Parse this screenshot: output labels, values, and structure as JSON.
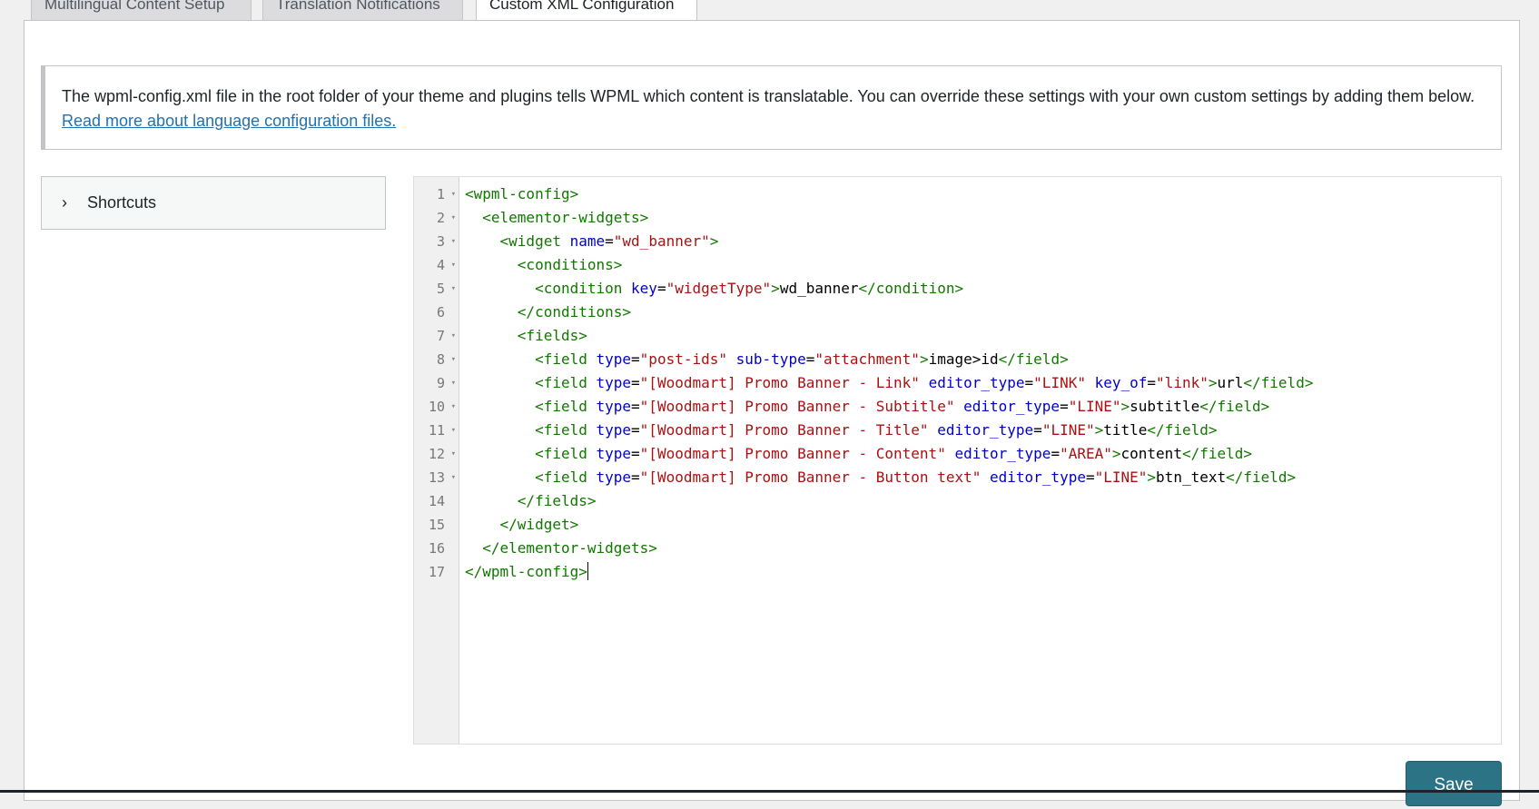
{
  "tabs": [
    {
      "label": "Multilingual Content Setup"
    },
    {
      "label": "Translation Notifications"
    },
    {
      "label": "Custom XML Configuration"
    }
  ],
  "notice": {
    "text": "The wpml-config.xml file in the root folder of your theme and plugins tells WPML which content is translatable. You can override these settings with your own custom settings by adding them below.",
    "link": "Read more about language configuration files."
  },
  "shortcuts": {
    "label": "Shortcuts",
    "icon": "chevron-right-icon"
  },
  "editor": {
    "lines": [
      {
        "num": "1",
        "fold": true,
        "indent": 0,
        "tokens": [
          [
            "tg",
            "<wpml-config>"
          ]
        ]
      },
      {
        "num": "2",
        "fold": true,
        "indent": 2,
        "tokens": [
          [
            "tg",
            "<elementor-widgets>"
          ]
        ]
      },
      {
        "num": "3",
        "fold": true,
        "indent": 4,
        "tokens": [
          [
            "tg",
            "<widget"
          ],
          [
            "tx",
            " "
          ],
          [
            "at",
            "name"
          ],
          [
            "tx",
            "="
          ],
          [
            "st",
            "\"wd_banner\""
          ],
          [
            "tg",
            ">"
          ]
        ]
      },
      {
        "num": "4",
        "fold": true,
        "indent": 6,
        "tokens": [
          [
            "tg",
            "<conditions>"
          ]
        ]
      },
      {
        "num": "5",
        "fold": true,
        "indent": 8,
        "tokens": [
          [
            "tg",
            "<condition"
          ],
          [
            "tx",
            " "
          ],
          [
            "at",
            "key"
          ],
          [
            "tx",
            "="
          ],
          [
            "st",
            "\"widgetType\""
          ],
          [
            "tg",
            ">"
          ],
          [
            "tx",
            "wd_banner"
          ],
          [
            "tg",
            "</condition>"
          ]
        ]
      },
      {
        "num": "6",
        "fold": false,
        "indent": 6,
        "tokens": [
          [
            "tg",
            "</conditions>"
          ]
        ]
      },
      {
        "num": "7",
        "fold": true,
        "indent": 6,
        "tokens": [
          [
            "tg",
            "<fields>"
          ]
        ]
      },
      {
        "num": "8",
        "fold": true,
        "indent": 8,
        "tokens": [
          [
            "tg",
            "<field"
          ],
          [
            "tx",
            " "
          ],
          [
            "at",
            "type"
          ],
          [
            "tx",
            "="
          ],
          [
            "st",
            "\"post-ids\""
          ],
          [
            "tx",
            " "
          ],
          [
            "at",
            "sub-type"
          ],
          [
            "tx",
            "="
          ],
          [
            "st",
            "\"attachment\""
          ],
          [
            "tg",
            ">"
          ],
          [
            "tx",
            "image>id"
          ],
          [
            "tg",
            "</field>"
          ]
        ]
      },
      {
        "num": "9",
        "fold": true,
        "indent": 8,
        "tokens": [
          [
            "tg",
            "<field"
          ],
          [
            "tx",
            " "
          ],
          [
            "at",
            "type"
          ],
          [
            "tx",
            "="
          ],
          [
            "st",
            "\"[Woodmart] Promo Banner - Link\""
          ],
          [
            "tx",
            " "
          ],
          [
            "at",
            "editor_type"
          ],
          [
            "tx",
            "="
          ],
          [
            "st",
            "\"LINK\""
          ],
          [
            "tx",
            " "
          ],
          [
            "at",
            "key_of"
          ],
          [
            "tx",
            "="
          ],
          [
            "st",
            "\"link\""
          ],
          [
            "tg",
            ">"
          ],
          [
            "tx",
            "url"
          ],
          [
            "tg",
            "</field>"
          ]
        ]
      },
      {
        "num": "10",
        "fold": true,
        "indent": 8,
        "tokens": [
          [
            "tg",
            "<field"
          ],
          [
            "tx",
            " "
          ],
          [
            "at",
            "type"
          ],
          [
            "tx",
            "="
          ],
          [
            "st",
            "\"[Woodmart] Promo Banner - Subtitle\""
          ],
          [
            "tx",
            " "
          ],
          [
            "at",
            "editor_type"
          ],
          [
            "tx",
            "="
          ],
          [
            "st",
            "\"LINE\""
          ],
          [
            "tg",
            ">"
          ],
          [
            "tx",
            "subtitle"
          ],
          [
            "tg",
            "</field>"
          ]
        ]
      },
      {
        "num": "11",
        "fold": true,
        "indent": 8,
        "tokens": [
          [
            "tg",
            "<field"
          ],
          [
            "tx",
            " "
          ],
          [
            "at",
            "type"
          ],
          [
            "tx",
            "="
          ],
          [
            "st",
            "\"[Woodmart] Promo Banner - Title\""
          ],
          [
            "tx",
            " "
          ],
          [
            "at",
            "editor_type"
          ],
          [
            "tx",
            "="
          ],
          [
            "st",
            "\"LINE\""
          ],
          [
            "tg",
            ">"
          ],
          [
            "tx",
            "title"
          ],
          [
            "tg",
            "</field>"
          ]
        ]
      },
      {
        "num": "12",
        "fold": true,
        "indent": 8,
        "tokens": [
          [
            "tg",
            "<field"
          ],
          [
            "tx",
            " "
          ],
          [
            "at",
            "type"
          ],
          [
            "tx",
            "="
          ],
          [
            "st",
            "\"[Woodmart] Promo Banner - Content\""
          ],
          [
            "tx",
            " "
          ],
          [
            "at",
            "editor_type"
          ],
          [
            "tx",
            "="
          ],
          [
            "st",
            "\"AREA\""
          ],
          [
            "tg",
            ">"
          ],
          [
            "tx",
            "content"
          ],
          [
            "tg",
            "</field>"
          ]
        ]
      },
      {
        "num": "13",
        "fold": true,
        "indent": 8,
        "tokens": [
          [
            "tg",
            "<field"
          ],
          [
            "tx",
            " "
          ],
          [
            "at",
            "type"
          ],
          [
            "tx",
            "="
          ],
          [
            "st",
            "\"[Woodmart] Promo Banner - Button text\""
          ],
          [
            "tx",
            " "
          ],
          [
            "at",
            "editor_type"
          ],
          [
            "tx",
            "="
          ],
          [
            "st",
            "\"LINE\""
          ],
          [
            "tg",
            ">"
          ],
          [
            "tx",
            "btn_text"
          ],
          [
            "tg",
            "</field>"
          ]
        ]
      },
      {
        "num": "14",
        "fold": false,
        "indent": 6,
        "tokens": [
          [
            "tg",
            "</fields>"
          ]
        ]
      },
      {
        "num": "15",
        "fold": false,
        "indent": 4,
        "tokens": [
          [
            "tg",
            "</widget>"
          ]
        ]
      },
      {
        "num": "16",
        "fold": false,
        "indent": 2,
        "tokens": [
          [
            "tg",
            "</elementor-widgets>"
          ]
        ]
      },
      {
        "num": "17",
        "fold": false,
        "indent": 0,
        "tokens": [
          [
            "tg",
            "</wpml-config>"
          ]
        ]
      }
    ]
  },
  "save_button": {
    "label": "Save"
  },
  "colors": {
    "tag": "#117700",
    "attribute": "#0000cc",
    "string": "#aa1111",
    "button": "#2c7385"
  }
}
